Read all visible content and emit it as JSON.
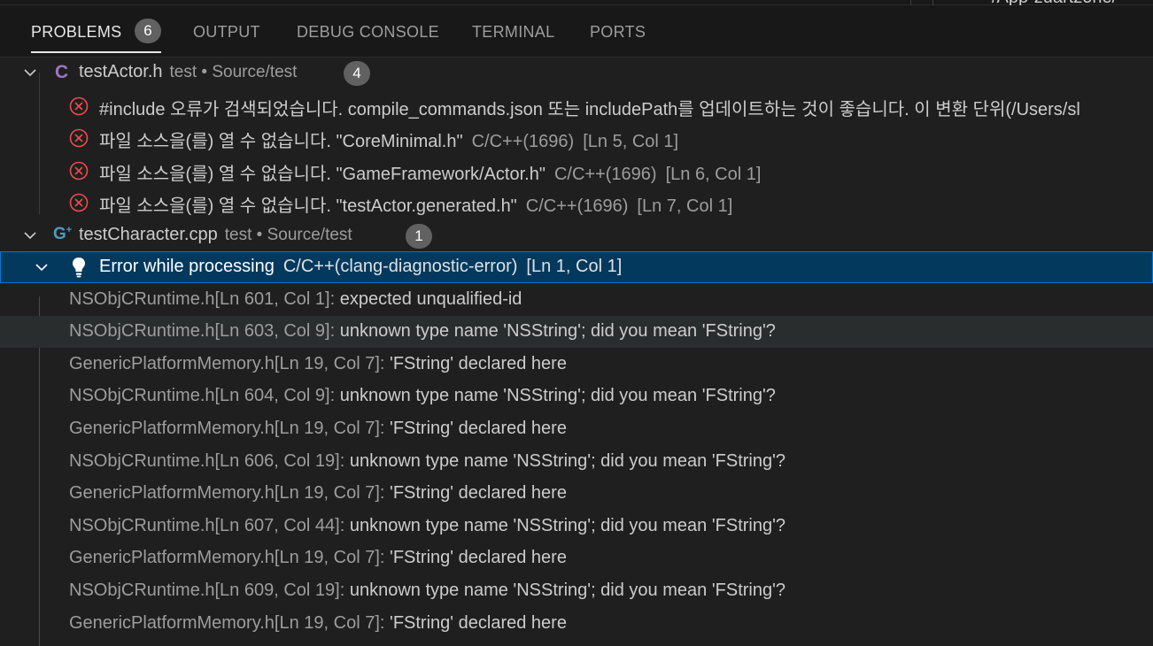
{
  "top_fragment": "/App-zuartzone/",
  "tabs": [
    {
      "label": "PROBLEMS",
      "badge": "6"
    },
    {
      "label": "OUTPUT"
    },
    {
      "label": "DEBUG CONSOLE"
    },
    {
      "label": "TERMINAL"
    },
    {
      "label": "PORTS"
    }
  ],
  "files": [
    {
      "icon_text": "C",
      "name": "testActor.h",
      "desc": "test • Source/test",
      "count": "4",
      "problems": [
        {
          "message": "#include 오류가 검색되었습니다. compile_commands.json 또는 includePath를 업데이트하는 것이 좋습니다. 이 변환 단위(/Users/sl",
          "source": "",
          "location": ""
        },
        {
          "message": "파일 소스을(를) 열 수 없습니다. \"CoreMinimal.h\"",
          "source": "C/C++(1696)",
          "location": "[Ln 5, Col 1]"
        },
        {
          "message": "파일 소스을(를) 열 수 없습니다. \"GameFramework/Actor.h\"",
          "source": "C/C++(1696)",
          "location": "[Ln 6, Col 1]"
        },
        {
          "message": "파일 소스을(를) 열 수 없습니다. \"testActor.generated.h\"",
          "source": "C/C++(1696)",
          "location": "[Ln 7, Col 1]"
        }
      ]
    },
    {
      "icon_text": "G",
      "name": "testCharacter.cpp",
      "desc": "test • Source/test",
      "count": "1",
      "problem": {
        "message": "Error while processing",
        "source": "C/C++(clang-diagnostic-error)",
        "location": "[Ln 1, Col 1]"
      },
      "related": [
        {
          "file": "NSObjCRuntime.h[Ln 601, Col 1]:",
          "text": "expected unqualified-id"
        },
        {
          "file": "NSObjCRuntime.h[Ln 603, Col 9]:",
          "text": "unknown type name 'NSString'; did you mean 'FString'?"
        },
        {
          "file": "GenericPlatformMemory.h[Ln 19, Col 7]:",
          "text": "'FString' declared here"
        },
        {
          "file": "NSObjCRuntime.h[Ln 604, Col 9]:",
          "text": "unknown type name 'NSString'; did you mean 'FString'?"
        },
        {
          "file": "GenericPlatformMemory.h[Ln 19, Col 7]:",
          "text": "'FString' declared here"
        },
        {
          "file": "NSObjCRuntime.h[Ln 606, Col 19]:",
          "text": "unknown type name 'NSString'; did you mean 'FString'?"
        },
        {
          "file": "GenericPlatformMemory.h[Ln 19, Col 7]:",
          "text": "'FString' declared here"
        },
        {
          "file": "NSObjCRuntime.h[Ln 607, Col 44]:",
          "text": "unknown type name 'NSString'; did you mean 'FString'?"
        },
        {
          "file": "GenericPlatformMemory.h[Ln 19, Col 7]:",
          "text": "'FString' declared here"
        },
        {
          "file": "NSObjCRuntime.h[Ln 609, Col 19]:",
          "text": "unknown type name 'NSString'; did you mean 'FString'?"
        },
        {
          "file": "GenericPlatformMemory.h[Ln 19, Col 7]:",
          "text": "'FString' declared here"
        }
      ]
    }
  ],
  "colors": {
    "error": "#f14c4c",
    "selection": "#04395e",
    "focus_border": "#0078d4",
    "c_icon": "#a074c4",
    "cpp_icon": "#519aba"
  }
}
